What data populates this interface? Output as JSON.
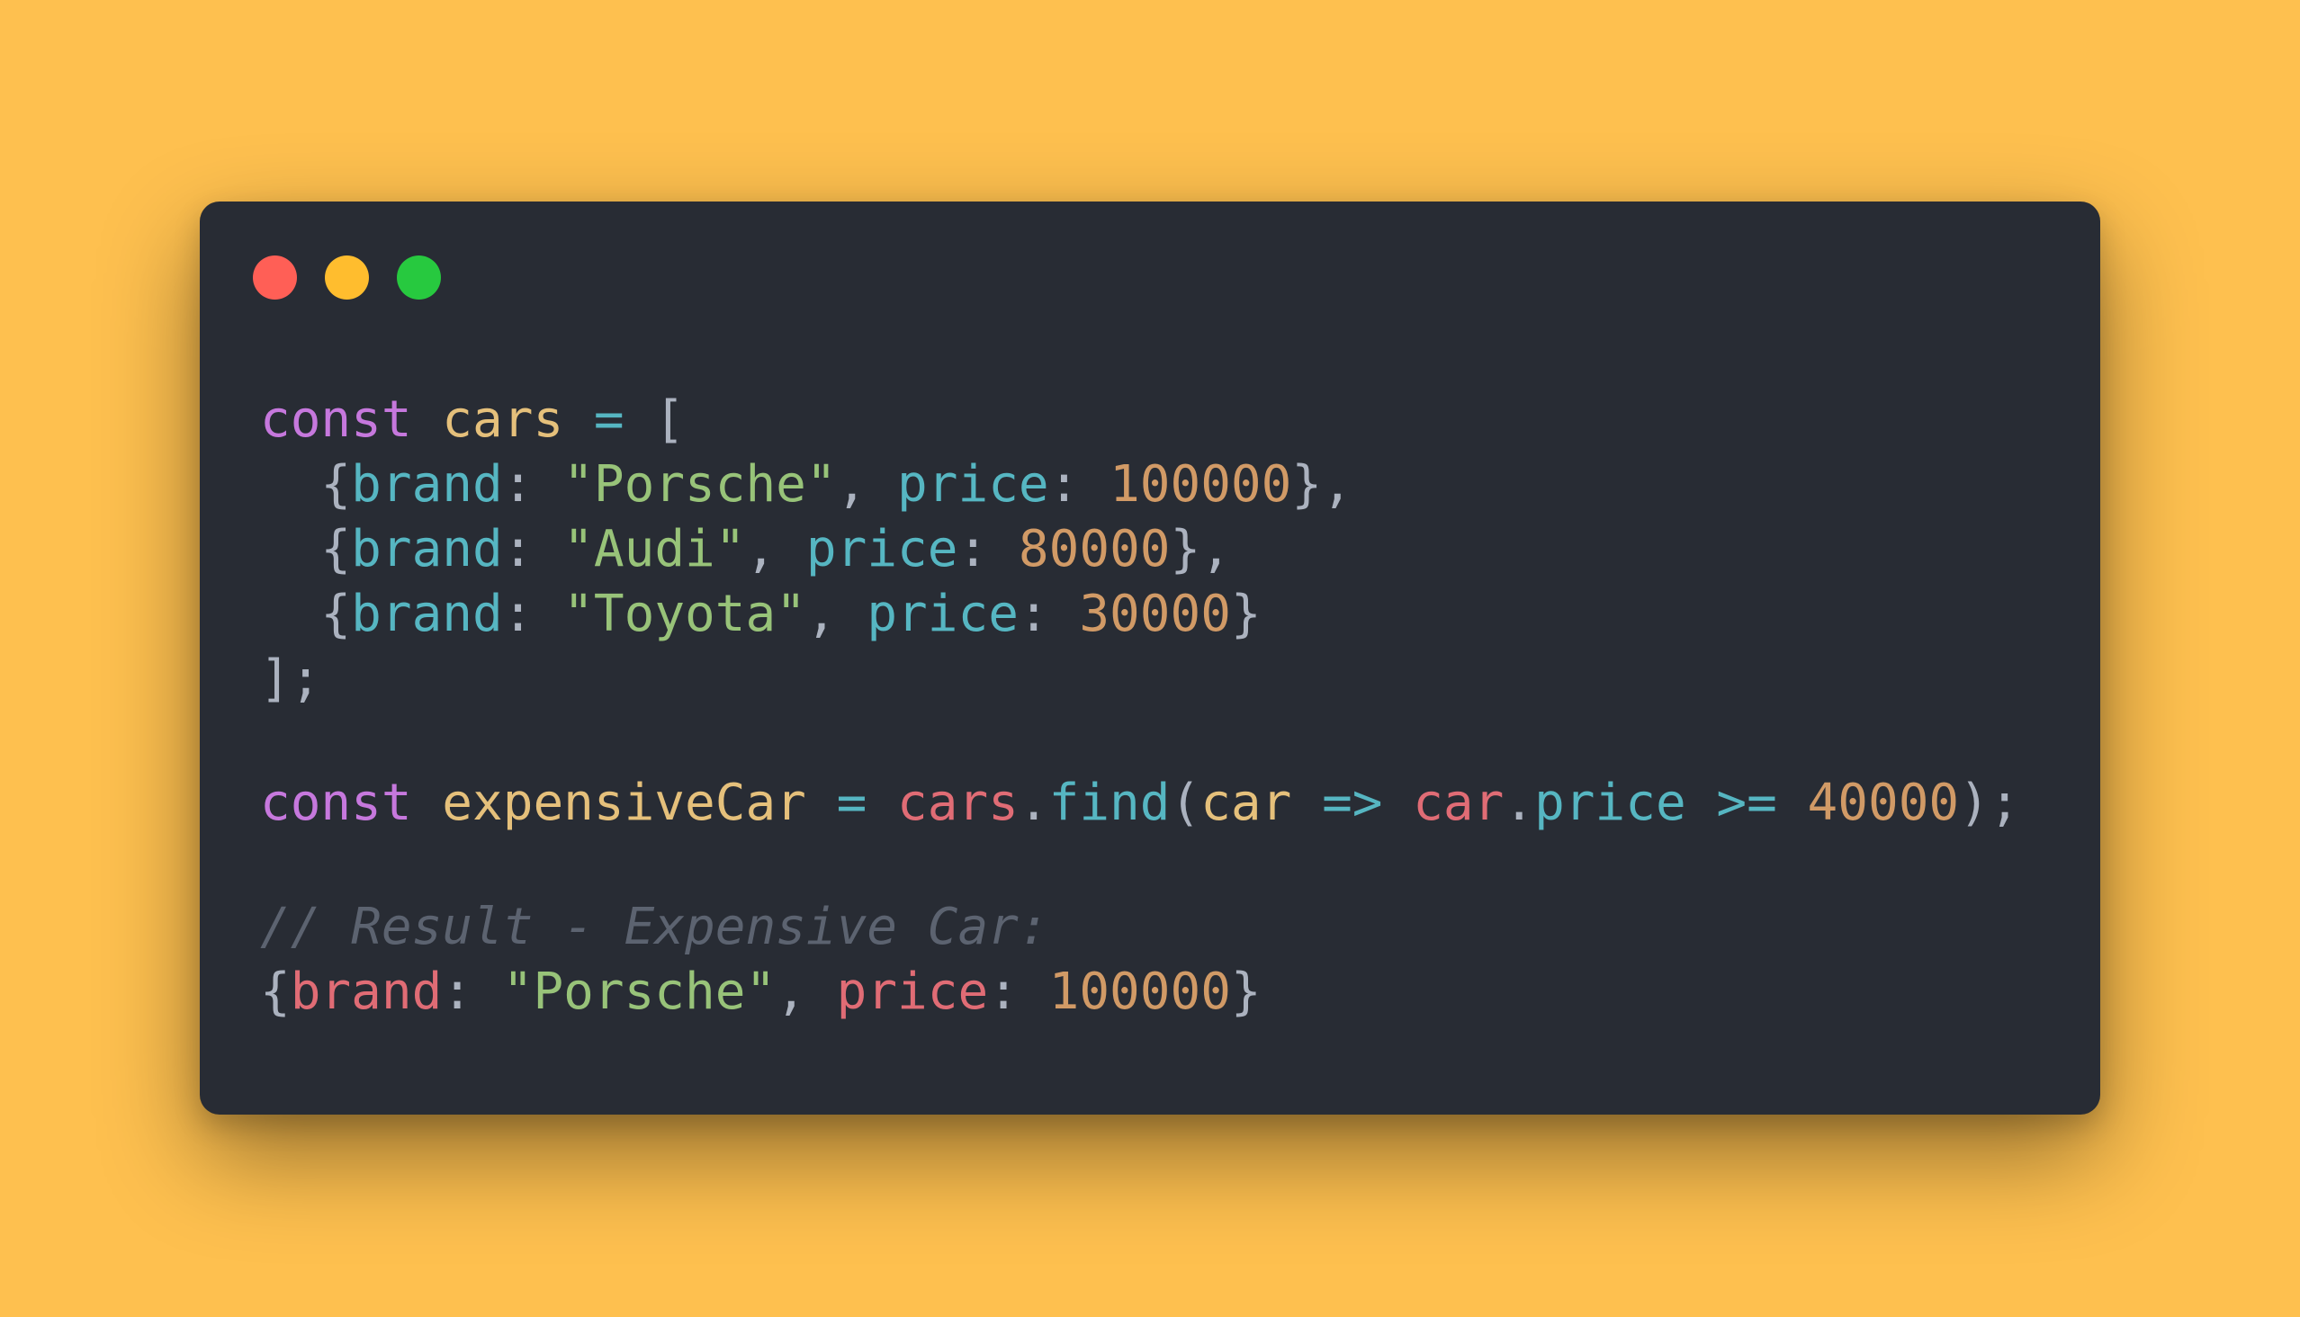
{
  "colors": {
    "background": "#FEC04F",
    "window": "#282C34",
    "traffic_close": "#FF5F56",
    "traffic_minimize": "#FFBD2E",
    "traffic_maximize": "#27C93F",
    "keyword": "#C678DD",
    "variable": "#E5C07B",
    "operator": "#56B6C2",
    "punctuation": "#ABB2BF",
    "property": "#56B6C2",
    "string": "#98C379",
    "number": "#D19A66",
    "identifier": "#E06C75",
    "function": "#56B6C2",
    "comment": "#5C6370"
  },
  "window": {
    "traffic_lights": [
      {
        "name": "close",
        "color": "#FF5F56"
      },
      {
        "name": "minimize",
        "color": "#FFBD2E"
      },
      {
        "name": "maximize",
        "color": "#27C93F"
      }
    ]
  },
  "code": {
    "lines": [
      {
        "tokens": [
          {
            "text": "const",
            "kind": "keyword"
          },
          {
            "text": " ",
            "kind": "punctuation"
          },
          {
            "text": "cars",
            "kind": "variable"
          },
          {
            "text": " ",
            "kind": "punctuation"
          },
          {
            "text": "=",
            "kind": "operator"
          },
          {
            "text": " [",
            "kind": "punctuation"
          }
        ]
      },
      {
        "tokens": [
          {
            "text": "  {",
            "kind": "punctuation"
          },
          {
            "text": "brand",
            "kind": "property"
          },
          {
            "text": ": ",
            "kind": "punctuation"
          },
          {
            "text": "\"Porsche\"",
            "kind": "string"
          },
          {
            "text": ", ",
            "kind": "punctuation"
          },
          {
            "text": "price",
            "kind": "property"
          },
          {
            "text": ": ",
            "kind": "punctuation"
          },
          {
            "text": "100000",
            "kind": "number"
          },
          {
            "text": "},",
            "kind": "punctuation"
          }
        ]
      },
      {
        "tokens": [
          {
            "text": "  {",
            "kind": "punctuation"
          },
          {
            "text": "brand",
            "kind": "property"
          },
          {
            "text": ": ",
            "kind": "punctuation"
          },
          {
            "text": "\"Audi\"",
            "kind": "string"
          },
          {
            "text": ", ",
            "kind": "punctuation"
          },
          {
            "text": "price",
            "kind": "property"
          },
          {
            "text": ": ",
            "kind": "punctuation"
          },
          {
            "text": "80000",
            "kind": "number"
          },
          {
            "text": "},",
            "kind": "punctuation"
          }
        ]
      },
      {
        "tokens": [
          {
            "text": "  {",
            "kind": "punctuation"
          },
          {
            "text": "brand",
            "kind": "property"
          },
          {
            "text": ": ",
            "kind": "punctuation"
          },
          {
            "text": "\"Toyota\"",
            "kind": "string"
          },
          {
            "text": ", ",
            "kind": "punctuation"
          },
          {
            "text": "price",
            "kind": "property"
          },
          {
            "text": ": ",
            "kind": "punctuation"
          },
          {
            "text": "30000",
            "kind": "number"
          },
          {
            "text": "}",
            "kind": "punctuation"
          }
        ]
      },
      {
        "tokens": [
          {
            "text": "];",
            "kind": "punctuation"
          }
        ]
      },
      {
        "gap_before": true,
        "tokens": [
          {
            "text": "const",
            "kind": "keyword"
          },
          {
            "text": " ",
            "kind": "punctuation"
          },
          {
            "text": "expensiveCar",
            "kind": "variable"
          },
          {
            "text": " ",
            "kind": "punctuation"
          },
          {
            "text": "=",
            "kind": "operator"
          },
          {
            "text": " ",
            "kind": "punctuation"
          },
          {
            "text": "cars",
            "kind": "identifier"
          },
          {
            "text": ".",
            "kind": "punctuation"
          },
          {
            "text": "find",
            "kind": "function"
          },
          {
            "text": "(",
            "kind": "punctuation"
          },
          {
            "text": "car",
            "kind": "variable"
          },
          {
            "text": " ",
            "kind": "punctuation"
          },
          {
            "text": "=>",
            "kind": "operator"
          },
          {
            "text": " ",
            "kind": "punctuation"
          },
          {
            "text": "car",
            "kind": "identifier"
          },
          {
            "text": ".",
            "kind": "punctuation"
          },
          {
            "text": "price",
            "kind": "property"
          },
          {
            "text": " ",
            "kind": "punctuation"
          },
          {
            "text": ">=",
            "kind": "operator"
          },
          {
            "text": " ",
            "kind": "punctuation"
          },
          {
            "text": "40000",
            "kind": "number"
          },
          {
            "text": ");",
            "kind": "punctuation"
          }
        ]
      },
      {
        "gap_before": true,
        "tokens": [
          {
            "text": "// Result - Expensive Car:",
            "kind": "comment"
          }
        ]
      },
      {
        "tokens": [
          {
            "text": "{",
            "kind": "punctuation"
          },
          {
            "text": "brand",
            "kind": "identifier"
          },
          {
            "text": ": ",
            "kind": "punctuation"
          },
          {
            "text": "\"Porsche\"",
            "kind": "string"
          },
          {
            "text": ", ",
            "kind": "punctuation"
          },
          {
            "text": "price",
            "kind": "identifier"
          },
          {
            "text": ": ",
            "kind": "punctuation"
          },
          {
            "text": "100000",
            "kind": "number"
          },
          {
            "text": "}",
            "kind": "punctuation"
          }
        ]
      }
    ]
  }
}
